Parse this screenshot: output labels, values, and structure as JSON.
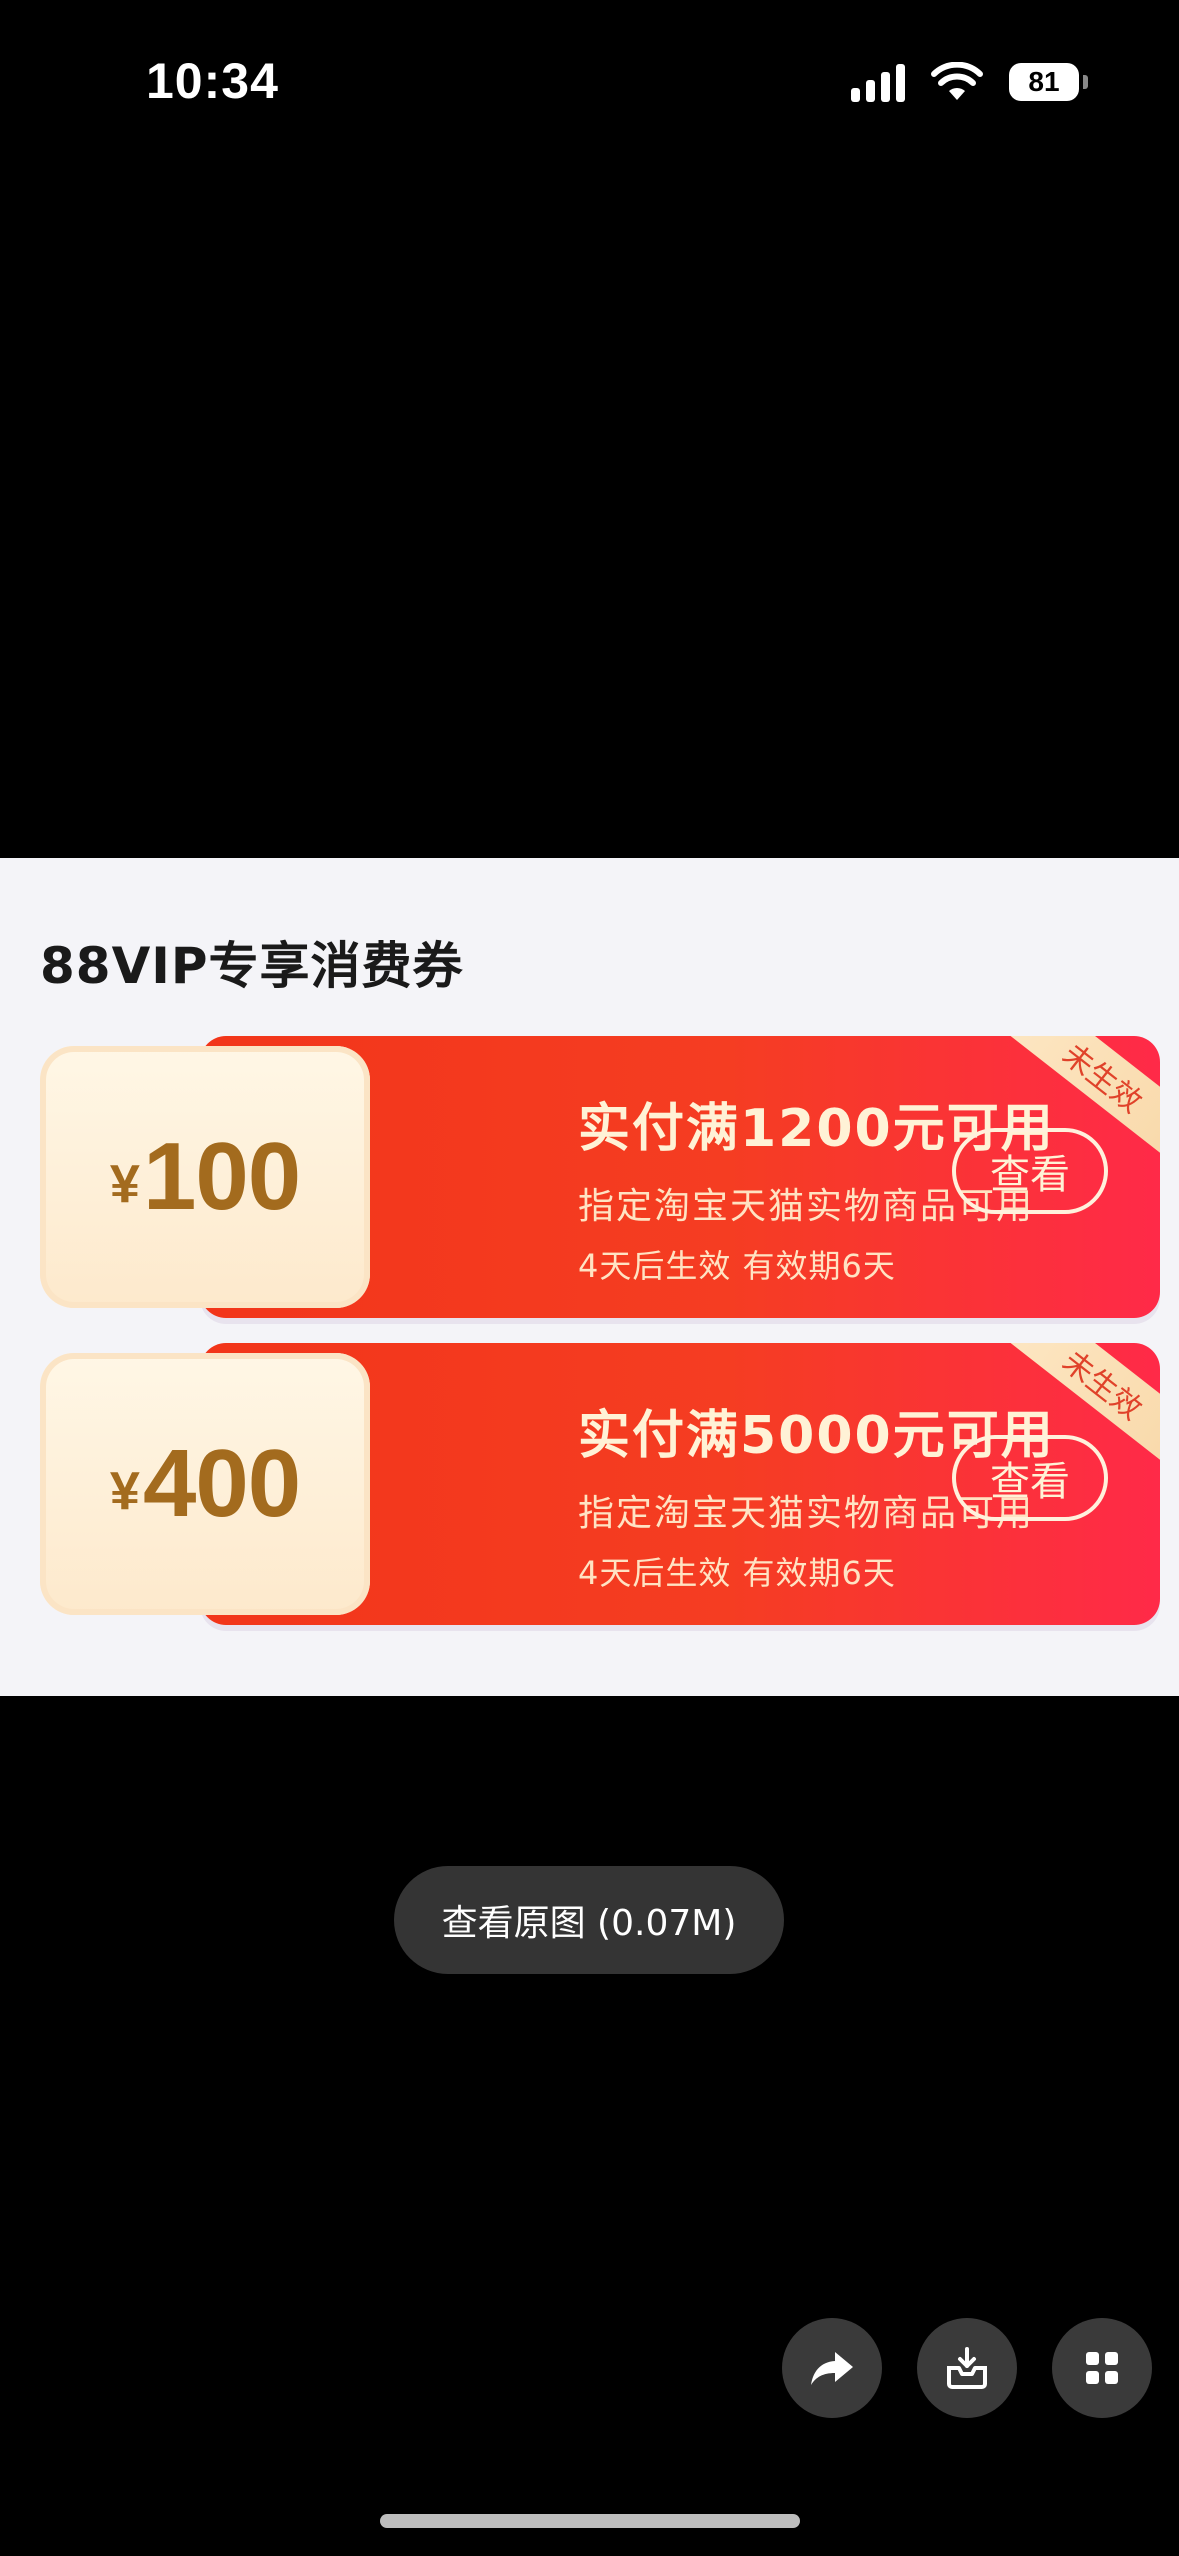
{
  "status_bar": {
    "time": "10:34",
    "battery": "81"
  },
  "image": {
    "title": "88VIP专享消费券",
    "coupons": [
      {
        "currency": "¥",
        "amount": "100",
        "title": "实付满1200元可用",
        "desc": "指定淘宝天猫实物商品可用",
        "validity": "4天后生效 有效期6天",
        "button": "查看",
        "tag": "未生效"
      },
      {
        "currency": "¥",
        "amount": "400",
        "title": "实付满5000元可用",
        "desc": "指定淘宝天猫实物商品可用",
        "validity": "4天后生效 有效期6天",
        "button": "查看",
        "tag": "未生效"
      }
    ]
  },
  "view_original": "查看原图 (0.07M)",
  "actions": {
    "share": "share-icon",
    "save": "download-icon",
    "more": "grid-icon"
  }
}
